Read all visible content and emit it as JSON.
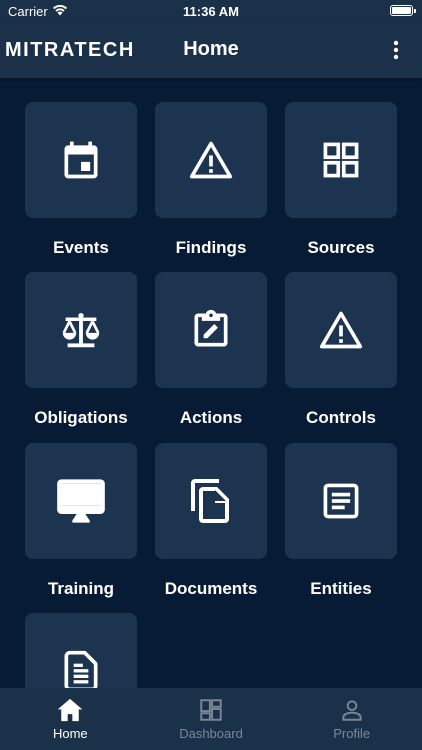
{
  "status_bar": {
    "carrier": "Carrier",
    "time": "11:36 AM"
  },
  "nav": {
    "logo": "MITRATECH",
    "title": "Home"
  },
  "tiles": [
    {
      "label": "Events",
      "icon": "calendar-icon"
    },
    {
      "label": "Findings",
      "icon": "warning-icon"
    },
    {
      "label": "Sources",
      "icon": "grid-icon"
    },
    {
      "label": "Obligations",
      "icon": "scale-icon"
    },
    {
      "label": "Actions",
      "icon": "clipboard-edit-icon"
    },
    {
      "label": "Controls",
      "icon": "warning-icon"
    },
    {
      "label": "Training",
      "icon": "monitor-icon"
    },
    {
      "label": "Documents",
      "icon": "copy-icon"
    },
    {
      "label": "Entities",
      "icon": "article-icon"
    },
    {
      "label": "",
      "icon": "document-icon"
    }
  ],
  "tab_bar": [
    {
      "label": "Home",
      "icon": "home-icon",
      "active": true
    },
    {
      "label": "Dashboard",
      "icon": "dashboard-icon",
      "active": false
    },
    {
      "label": "Profile",
      "icon": "person-icon",
      "active": false
    }
  ],
  "colors": {
    "background": "#071b34",
    "bar": "#1b3049",
    "card": "#1d3450",
    "inactive_tab": "#7b8794"
  }
}
